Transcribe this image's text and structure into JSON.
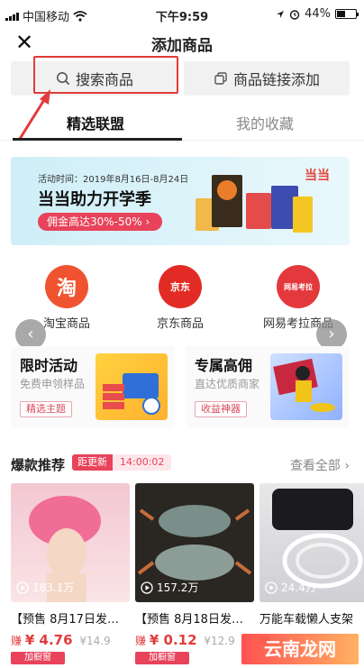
{
  "status_bar": {
    "carrier": "中国移动",
    "time": "下午9:59",
    "battery": "44%",
    "battery_level": 0.44
  },
  "header": {
    "title": "添加商品"
  },
  "search": {
    "search_label": "搜索商品",
    "link_label": "商品链接添加"
  },
  "tabs": [
    {
      "label": "精选联盟"
    },
    {
      "label": "我的收藏"
    }
  ],
  "banner": {
    "time": "活动时间：2019年8月16日-8月24日",
    "headline": "当当助力开学季",
    "promo": "佣金高达30%-50% ›",
    "logo": "当当"
  },
  "platforms": [
    {
      "label": "淘宝商品",
      "icon_text": "淘",
      "color": "#f0532f"
    },
    {
      "label": "京东商品",
      "icon_text": "京东",
      "color": "#e22b25"
    },
    {
      "label": "网易考拉商品",
      "icon_text": "网易考拉",
      "color": "#e4393c"
    }
  ],
  "activities": [
    {
      "title": "限时活动",
      "subtitle": "免费申领样品",
      "tag": "精选主题"
    },
    {
      "title": "专属高佣",
      "subtitle": "直达优质商家",
      "tag": "收益神器"
    }
  ],
  "hot": {
    "title": "爆款推荐",
    "countdown_label": "距更新",
    "countdown_value": "14:00:02",
    "view_all": "查看全部 ›"
  },
  "products": [
    {
      "name": "【预售 8月17日发…",
      "earn": "赚",
      "amount": "¥ 4.76",
      "orig": "¥14.9",
      "views": "183.1万",
      "btn": "加橱窗"
    },
    {
      "name": "【预售 8月18日发…",
      "earn": "赚",
      "amount": "¥ 0.12",
      "orig": "¥12.9",
      "views": "157.2万",
      "btn": "加橱窗"
    },
    {
      "name": "万能车载懒人支架",
      "earn": "赚",
      "amount": "",
      "orig": "",
      "views": "24.4万",
      "btn": ""
    }
  ],
  "watermark": "云南龙网",
  "colors": {
    "accent": "#e8435a",
    "highlight": "#e23b3b"
  }
}
